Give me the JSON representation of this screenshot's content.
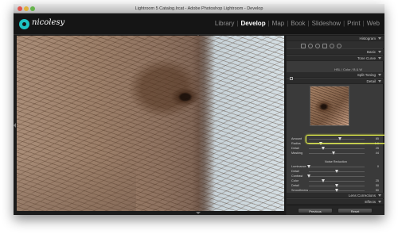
{
  "window": {
    "title": "Lightroom 5 Catalog.lrcat - Adobe Photoshop Lightroom - Develop"
  },
  "identity": {
    "logo_text": "nicolesy"
  },
  "modules": [
    {
      "label": "Library",
      "active": false
    },
    {
      "label": "Develop",
      "active": true
    },
    {
      "label": "Map",
      "active": false
    },
    {
      "label": "Book",
      "active": false
    },
    {
      "label": "Slideshow",
      "active": false
    },
    {
      "label": "Print",
      "active": false
    },
    {
      "label": "Web",
      "active": false
    }
  ],
  "panels": {
    "histogram": "Histogram",
    "basic": "Basic",
    "tone_curve": "Tone Curve",
    "hsl_tabs": "HSL / Color / B & W",
    "split_toning": "Split Toning",
    "detail": "Detail",
    "lens_corrections": "Lens Corrections",
    "effects": "Effects"
  },
  "detail": {
    "sharpening": [
      {
        "label": "Amount",
        "value": "85",
        "pct": 0.55
      },
      {
        "label": "Radius",
        "value": "1.0",
        "pct": 0.22
      },
      {
        "label": "Detail",
        "value": "25",
        "pct": 0.25
      },
      {
        "label": "Masking",
        "value": "44",
        "pct": 0.44
      }
    ],
    "noise_reduction_title": "Noise Reduction",
    "noise_reduction": [
      {
        "label": "Luminance",
        "value": "0",
        "pct": 0.0
      },
      {
        "label": "Detail",
        "value": "",
        "pct": 0.5
      },
      {
        "label": "Contrast",
        "value": "",
        "pct": 0.0
      },
      {
        "label": "Color",
        "value": "25",
        "pct": 0.25
      },
      {
        "label": "Detail",
        "value": "50",
        "pct": 0.5
      },
      {
        "label": "Smoothness",
        "value": "50",
        "pct": 0.5
      }
    ]
  },
  "buttons": {
    "previous": "Previous",
    "reset": "Reset"
  },
  "colors": {
    "highlight": "#e9f54a",
    "logo_accent": "#1ec3c3"
  }
}
